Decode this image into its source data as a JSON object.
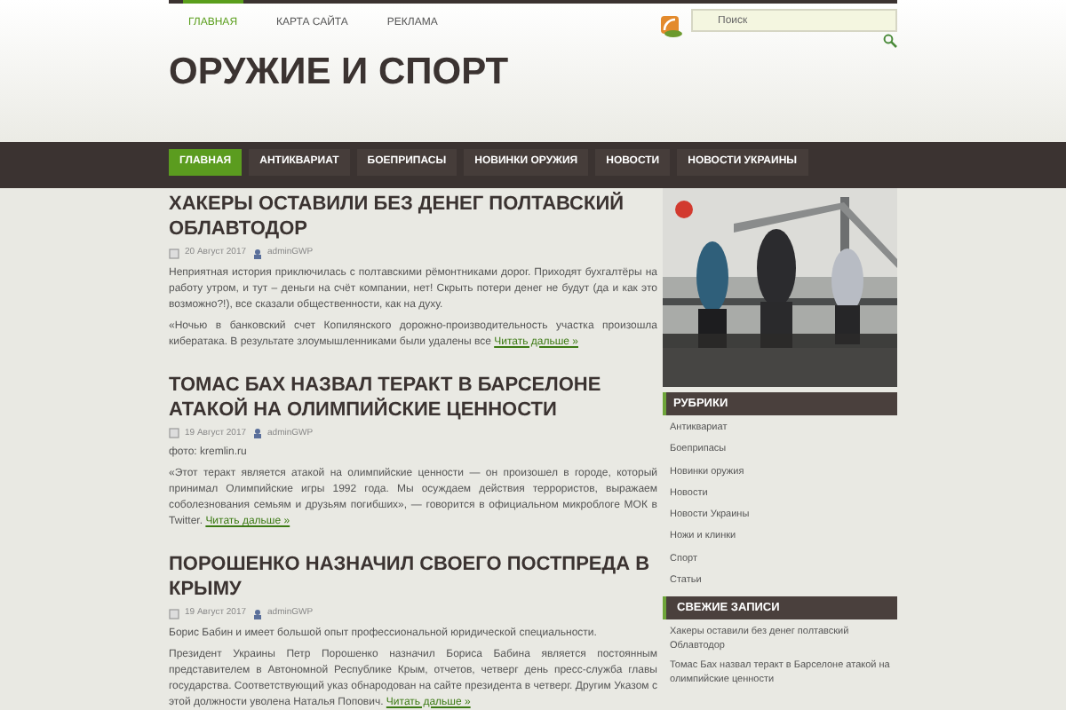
{
  "top_menu": [
    {
      "label": "ГЛАВНАЯ",
      "selected": true
    },
    {
      "label": "КАРТА САЙТА",
      "selected": false
    },
    {
      "label": "РЕКЛАМА",
      "selected": false
    }
  ],
  "search": {
    "placeholder": "Поиск"
  },
  "site_title": "ОРУЖИЕ И СПОРТ",
  "main_menu": [
    {
      "label": "ГЛАВНАЯ",
      "selected": true
    },
    {
      "label": "АНТИКВАРИАТ",
      "selected": false
    },
    {
      "label": "БОЕПРИПАСЫ",
      "selected": false
    },
    {
      "label": "НОВИНКИ ОРУЖИЯ",
      "selected": false
    },
    {
      "label": "НОВОСТИ",
      "selected": false
    },
    {
      "label": "НОВОСТИ УКРАИНЫ",
      "selected": false
    }
  ],
  "posts": [
    {
      "title": "ХАКЕРЫ ОСТАВИЛИ БЕЗ ДЕНЕГ ПОЛТАВСКИЙ ОБЛАВТОДОР",
      "date": "20 Август 2017",
      "author": "adminGWP",
      "paragraphs": [
        "Неприятная история приключилась с полтавскими рёмонтниками дорог. Приходят бухгалтёры на работу утром, и тут – деньги на счёт компании, нет! Скрыть потери денег не будут (да и как это возможно?!), все сказали общественности, как на духу.",
        "«Ночью в банковский счет Копилянского дорожно-производительность участка произошла кибератака. В результате злоумышленниками были удалены все"
      ],
      "more": "Читать дальше »"
    },
    {
      "title": "ТОМАС БАХ НАЗВАЛ ТЕРАКТ В БАРСЕЛОНЕ АТАКОЙ НА ОЛИМПИЙСКИЕ ЦЕННОСТИ",
      "date": "19 Август 2017",
      "author": "adminGWP",
      "paragraphs": [
        "фото: kremlin.ru",
        "«Этот теракт является атакой на олимпийские ценности — он произошел в городе, который принимал Олимпийские игры 1992 года. Мы осуждаем действия террористов, выражаем соболезнования семьям и друзьям погибших», — говорится в официальном микроблоге МОК в Twitter."
      ],
      "more": "Читать дальше »"
    },
    {
      "title": "ПОРОШЕНКО НАЗНАЧИЛ СВОЕГО ПОСТПРЕДА В КРЫМУ",
      "date": "19 Август 2017",
      "author": "adminGWP",
      "paragraphs": [
        "Борис Бабин и имеет большой опыт профессиональной юридической специальности.",
        "Президент Украины Петр Порошенко назначил Бориса Бабина является постоянным представителем в Автономной Республике Крым, отчетов, четверг день пресс-служба главы государства. Соответствующий указ обнародован на сайте президента в четверг. Другим Указом с этой должности уволена Наталья Попович."
      ],
      "more": "Читать дальше »"
    }
  ],
  "sidebar": {
    "categories_title": "РУБРИКИ",
    "categories": [
      "Антиквариат",
      "Боеприпасы",
      "Новинки оружия",
      "Новости",
      "Новости Украины",
      "Ножи и клинки",
      "Спорт",
      "Статьи"
    ],
    "recent_title": "СВЕЖИЕ ЗАПИСИ",
    "recent": [
      "Хакеры оставили без денег полтавский Облавтодор",
      "Томас Бах назвал теракт в Барселоне атакой на олимпийские ценности"
    ]
  }
}
